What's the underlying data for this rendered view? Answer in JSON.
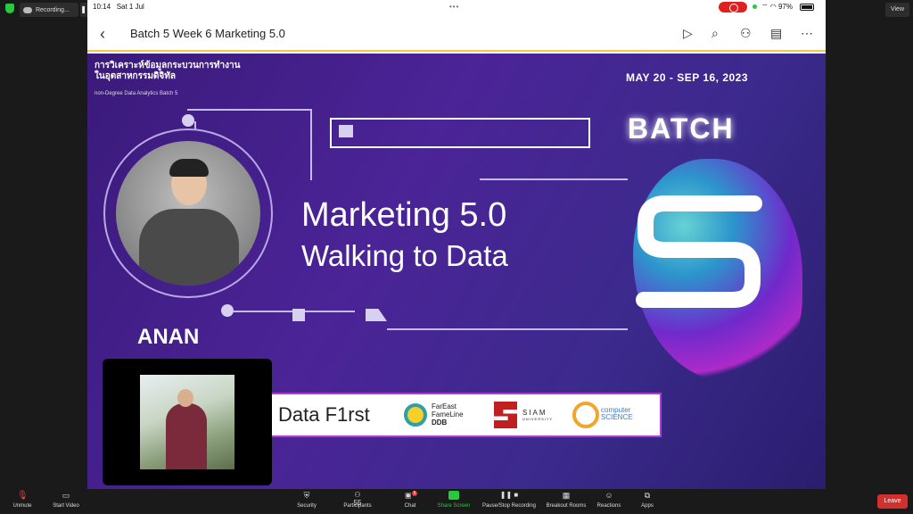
{
  "top_strip": {
    "recording_label": "Recording...",
    "view_label": "View"
  },
  "status_bar": {
    "time": "10:14",
    "date": "Sat 1 Jul",
    "battery": "97%"
  },
  "app_bar": {
    "title": "Batch 5 Week 6 Marketing 5.0"
  },
  "slide": {
    "thai_title_line1": "การวิเคราะห์ข้อมูลกระบวนการทำงาน",
    "thai_title_line2": "ในอุตสาหกรรมดิจิทัล",
    "subtitle": "non-Degree Data Analytics Batch 5",
    "date_range": "MAY 20 - SEP 16, 2023",
    "batch_label": "BATCH",
    "batch_number": "5",
    "headline1": "Marketing 5.0",
    "headline2": "Walking to Data",
    "speaker": "ANAN",
    "logos": {
      "data_first": "Data F1rst",
      "fareast_line1": "FarEast",
      "fareast_line2": "FameLine",
      "fareast_line3": "DDB",
      "siam": "SIAM",
      "siam_sub": "UNIVERSITY",
      "cs_line1": "computer",
      "cs_line2": "SCIENCE"
    }
  },
  "toolbar": {
    "unmute": "Unmute",
    "start_video": "Start Video",
    "security": "Security",
    "participants": "Participants",
    "participants_count": "55",
    "chat": "Chat",
    "chat_badge": "5",
    "share_screen": "Share Screen",
    "pause_recording": "Pause/Stop Recording",
    "breakout": "Breakout Rooms",
    "reactions": "Reactions",
    "apps": "Apps",
    "leave": "Leave"
  },
  "colors": {
    "accent_green": "#27c93f",
    "leave_red": "#d22f2f",
    "slide_purple": "#4b2497"
  }
}
